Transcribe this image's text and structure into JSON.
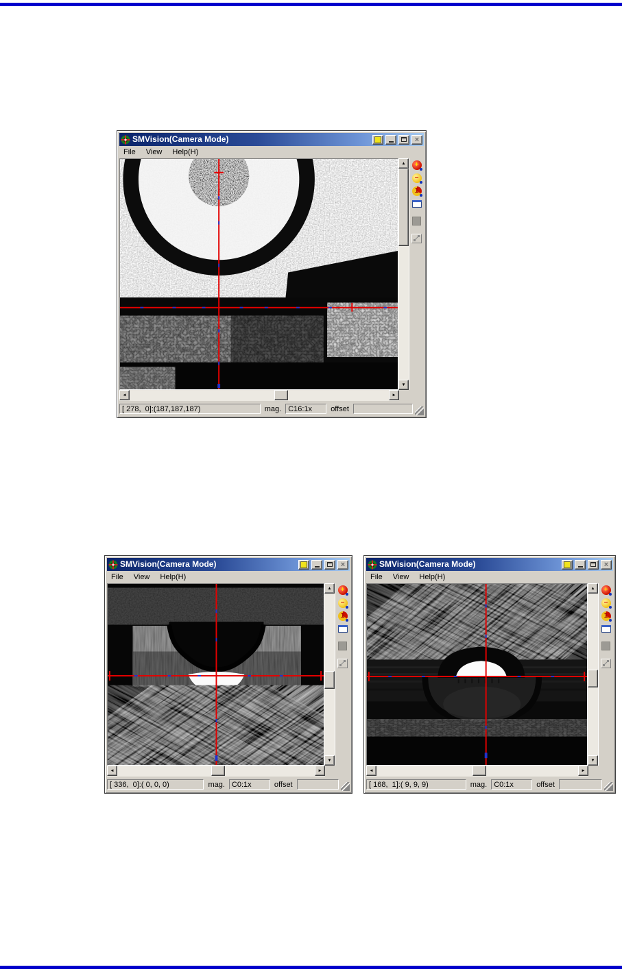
{
  "page": {
    "rule_color": "#0000cc"
  },
  "toolbar": {
    "zoom_in_glyph": "+",
    "zoom_out_glyph": "−",
    "zoom_one_glyph": "1"
  },
  "scroll": {
    "up_glyph": "▲",
    "down_glyph": "▼",
    "left_glyph": "◄",
    "right_glyph": "►"
  },
  "windows": [
    {
      "title": "SMVision(Camera Mode)",
      "menu": {
        "file": "File",
        "view": "View",
        "help": "Help(H)"
      },
      "status": {
        "coords": "[ 278,  0]:(187,187,187)",
        "mag_label": "mag.",
        "mag_value": "C16:1x",
        "offset_label": "offset",
        "offset_value": ""
      }
    },
    {
      "title": "SMVision(Camera Mode)",
      "menu": {
        "file": "File",
        "view": "View",
        "help": "Help(H)"
      },
      "status": {
        "coords": "[ 336,  0]:( 0, 0, 0)",
        "mag_label": "mag.",
        "mag_value": "C0:1x",
        "offset_label": "offset",
        "offset_value": ""
      }
    },
    {
      "title": "SMVision(Camera Mode)",
      "menu": {
        "file": "File",
        "view": "View",
        "help": "Help(H)"
      },
      "status": {
        "coords": "[ 168,  1]:( 9, 9, 9)",
        "mag_label": "mag.",
        "mag_value": "C0:1x",
        "offset_label": "offset",
        "offset_value": ""
      }
    }
  ]
}
